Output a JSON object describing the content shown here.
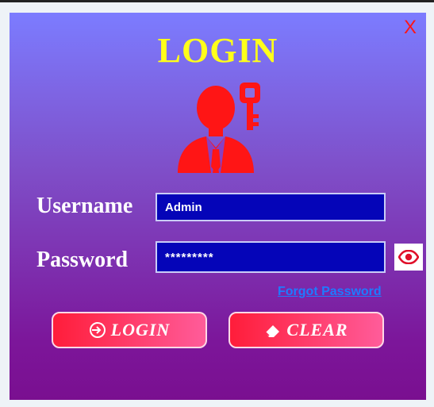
{
  "window": {
    "title": "LOGIN",
    "close_label": "X"
  },
  "form": {
    "username_label": "Username",
    "username_value": "Admin",
    "password_label": "Password",
    "password_value": "*********",
    "forgot_password": "Forgot Password"
  },
  "buttons": {
    "login_label": "LOGIN",
    "clear_label": "CLEAR"
  },
  "icons": {
    "user": "user-key-icon",
    "eye": "eye-icon",
    "login": "login-icon",
    "clear": "eraser-icon"
  },
  "colors": {
    "accent_red": "#ff1515",
    "title_yellow": "#ffff1a",
    "field_blue": "#0505b8",
    "link_blue": "#1e7bff"
  }
}
